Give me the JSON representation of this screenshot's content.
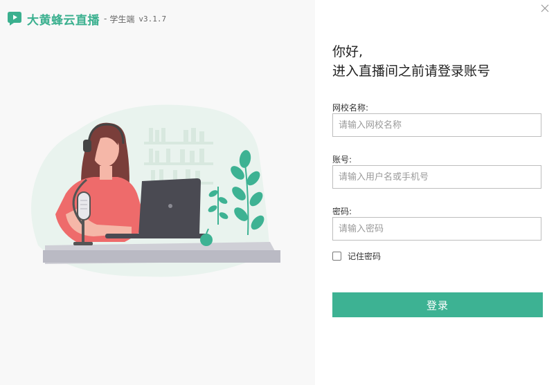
{
  "brand": {
    "name": "大黄蜂云直播",
    "separator": "-",
    "subtitle": "学生端",
    "version": "v3.1.7",
    "color": "#3bb08f"
  },
  "window": {
    "close_icon": "close-icon"
  },
  "greeting": {
    "line1": "你好,",
    "line2": "进入直播间之前请登录账号"
  },
  "form": {
    "school": {
      "label": "网校名称:",
      "placeholder": "请输入网校名称",
      "value": ""
    },
    "account": {
      "label": "账号:",
      "placeholder": "请输入用户名或手机号",
      "value": ""
    },
    "password": {
      "label": "密码:",
      "placeholder": "请输入密码",
      "value": ""
    },
    "remember": {
      "label": "记住密码",
      "checked": false
    },
    "submit_label": "登录"
  },
  "colors": {
    "accent": "#3db293",
    "left_bg": "#f8f8f8"
  }
}
